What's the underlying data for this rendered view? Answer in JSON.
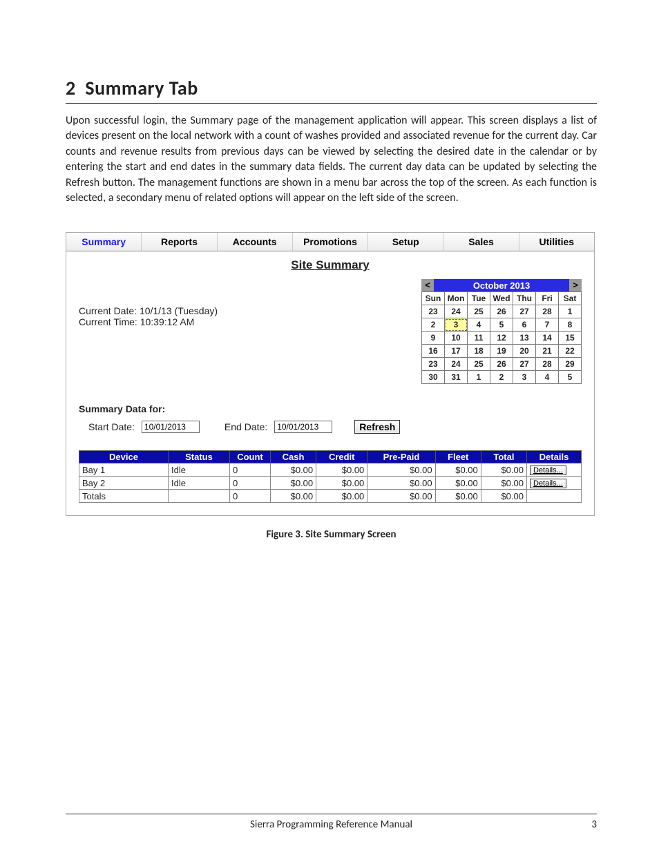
{
  "doc": {
    "heading_number": "2",
    "heading_text": "Summary Tab",
    "body": "Upon successful login, the Summary page of the management application will appear. This screen displays a list of devices present on the local network with a count of washes provided and associated revenue for the current day. Car counts and revenue results from previous days can be viewed by selecting the desired date in the calendar or by entering the start and end dates in the summary data fields. The current day data can be updated by selecting the Refresh button. The management functions are shown in a menu bar across the top of the screen. As each function is selected, a secondary menu of related options will appear on the left side of the screen.",
    "figure_caption": "Figure 3. Site Summary Screen",
    "footer_center": "Sierra Programming Reference Manual",
    "footer_page": "3"
  },
  "app": {
    "menu": {
      "items": [
        "Summary",
        "Reports",
        "Accounts",
        "Promotions",
        "Setup",
        "Sales",
        "Utilities"
      ],
      "active_index": 0
    },
    "title": "Site Summary",
    "current_date_label": "Current Date:",
    "current_date_value": "10/1/13 (Tuesday)",
    "current_time_label": "Current Time:",
    "current_time_value": "10:39:12 AM",
    "calendar": {
      "prev": "<",
      "next": ">",
      "month_label": "October 2013",
      "weekdays": [
        "Sun",
        "Mon",
        "Tue",
        "Wed",
        "Thu",
        "Fri",
        "Sat"
      ],
      "rows": [
        [
          "23",
          "24",
          "25",
          "26",
          "27",
          "28",
          "1"
        ],
        [
          "2",
          "3",
          "4",
          "5",
          "6",
          "7",
          "8"
        ],
        [
          "9",
          "10",
          "11",
          "12",
          "13",
          "14",
          "15"
        ],
        [
          "16",
          "17",
          "18",
          "19",
          "20",
          "21",
          "22"
        ],
        [
          "23",
          "24",
          "25",
          "26",
          "27",
          "28",
          "29"
        ],
        [
          "30",
          "31",
          "1",
          "2",
          "3",
          "4",
          "5"
        ]
      ],
      "highlight_row": 1,
      "highlight_col": 1
    },
    "summary_data_label": "Summary Data for:",
    "start_date_label": "Start Date:",
    "start_date_value": "10/01/2013",
    "end_date_label": "End Date:",
    "end_date_value": "10/01/2013",
    "refresh_label": "Refresh",
    "table": {
      "headers": [
        "Device",
        "Status",
        "Count",
        "Cash",
        "Credit",
        "Pre-Paid",
        "Fleet",
        "Total",
        "Details"
      ],
      "rows": [
        {
          "device": "Bay 1",
          "status": "Idle",
          "count": "0",
          "cash": "$0.00",
          "credit": "$0.00",
          "prepaid": "$0.00",
          "fleet": "$0.00",
          "total": "$0.00",
          "details": "Details..."
        },
        {
          "device": "Bay 2",
          "status": "Idle",
          "count": "0",
          "cash": "$0.00",
          "credit": "$0.00",
          "prepaid": "$0.00",
          "fleet": "$0.00",
          "total": "$0.00",
          "details": "Details..."
        },
        {
          "device": "Totals",
          "status": "",
          "count": "0",
          "cash": "$0.00",
          "credit": "$0.00",
          "prepaid": "$0.00",
          "fleet": "$0.00",
          "total": "$0.00",
          "details": ""
        }
      ]
    }
  }
}
